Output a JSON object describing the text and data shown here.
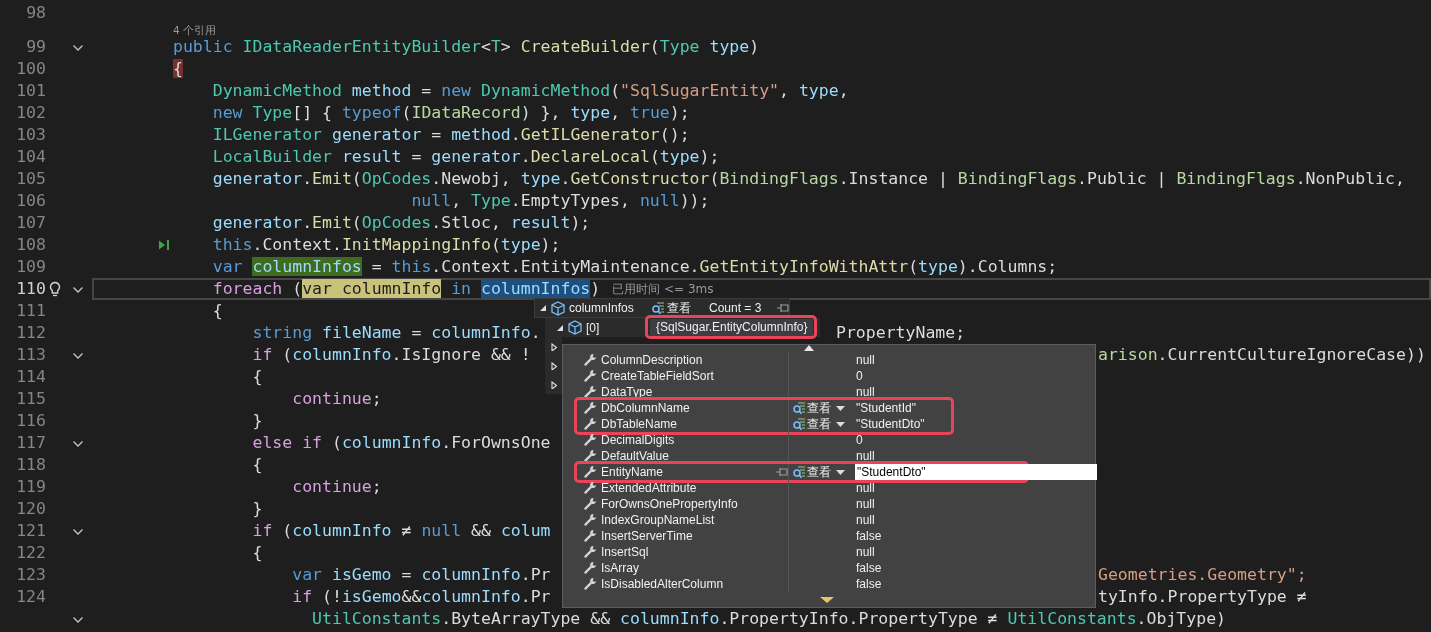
{
  "editor": {
    "lines": [
      {
        "number": "98",
        "current": false,
        "foldable": false
      },
      {
        "number": "99",
        "current": false,
        "foldable": true,
        "codelens": "4 个引用",
        "tokens": [
          {
            "text": "public ",
            "kind": "keyword"
          },
          {
            "text": "IDataReaderEntityBuilder",
            "kind": "type"
          },
          {
            "text": "<",
            "kind": "plain"
          },
          {
            "text": "T",
            "kind": "type"
          },
          {
            "text": "> ",
            "kind": "plain"
          },
          {
            "text": "CreateBuilder",
            "kind": "method"
          },
          {
            "text": "(",
            "kind": "plain"
          },
          {
            "text": "Type",
            "kind": "type"
          },
          {
            "text": " type",
            "kind": "variable"
          },
          {
            "text": ")",
            "kind": "plain"
          }
        ]
      },
      {
        "number": "100",
        "current": false,
        "foldable": false,
        "tokens": [
          {
            "text": "{",
            "kind": "plain",
            "color": "#7a2f2f"
          }
        ]
      },
      {
        "number": "101",
        "current": false,
        "foldable": false,
        "tokens": [
          {
            "text": "    DynamicMethod",
            "kind": "type"
          },
          {
            "text": " method",
            "kind": "variable"
          },
          {
            "text": " = ",
            "kind": "plain"
          },
          {
            "text": "new ",
            "kind": "keyword"
          },
          {
            "text": "DynamicMethod",
            "kind": "type"
          },
          {
            "text": "(",
            "kind": "plain"
          },
          {
            "text": "\"SqlSugarEntity\"",
            "kind": "string"
          },
          {
            "text": ", ",
            "kind": "plain"
          },
          {
            "text": "type",
            "kind": "variable"
          },
          {
            "text": ",",
            "kind": "plain"
          }
        ]
      },
      {
        "number": "102",
        "current": false,
        "foldable": false,
        "tokens": [
          {
            "text": "    new ",
            "kind": "keyword"
          },
          {
            "text": "Type",
            "kind": "type"
          },
          {
            "text": "[] { ",
            "kind": "plain"
          },
          {
            "text": "typeof",
            "kind": "keyword"
          },
          {
            "text": "(",
            "kind": "plain"
          },
          {
            "text": "IDataRecord",
            "kind": "enum"
          },
          {
            "text": ") }, ",
            "kind": "plain"
          },
          {
            "text": "type",
            "kind": "variable"
          },
          {
            "text": ", ",
            "kind": "plain"
          },
          {
            "text": "true",
            "kind": "keyword"
          },
          {
            "text": ");",
            "kind": "plain"
          }
        ]
      },
      {
        "number": "103",
        "current": false,
        "foldable": false,
        "tokens": [
          {
            "text": "    ILGenerator",
            "kind": "type"
          },
          {
            "text": " generator",
            "kind": "variable"
          },
          {
            "text": " = ",
            "kind": "plain"
          },
          {
            "text": "method",
            "kind": "variable"
          },
          {
            "text": ".",
            "kind": "plain"
          },
          {
            "text": "GetILGenerator",
            "kind": "method"
          },
          {
            "text": "();",
            "kind": "plain"
          }
        ]
      },
      {
        "number": "104",
        "current": false,
        "foldable": false,
        "tokens": [
          {
            "text": "    LocalBuilder",
            "kind": "type"
          },
          {
            "text": " result",
            "kind": "variable"
          },
          {
            "text": " = ",
            "kind": "plain"
          },
          {
            "text": "generator",
            "kind": "variable"
          },
          {
            "text": ".",
            "kind": "plain"
          },
          {
            "text": "DeclareLocal",
            "kind": "method"
          },
          {
            "text": "(",
            "kind": "plain"
          },
          {
            "text": "type",
            "kind": "variable"
          },
          {
            "text": ");",
            "kind": "plain"
          }
        ]
      },
      {
        "number": "105",
        "current": false,
        "foldable": false,
        "tokens": [
          {
            "text": "    generator",
            "kind": "variable"
          },
          {
            "text": ".",
            "kind": "plain"
          },
          {
            "text": "Emit",
            "kind": "method"
          },
          {
            "text": "(",
            "kind": "plain"
          },
          {
            "text": "OpCodes",
            "kind": "type"
          },
          {
            "text": ".Newobj, ",
            "kind": "plain"
          },
          {
            "text": "type",
            "kind": "variable"
          },
          {
            "text": ".",
            "kind": "plain"
          },
          {
            "text": "GetConstructor",
            "kind": "method"
          },
          {
            "text": "(",
            "kind": "plain"
          },
          {
            "text": "BindingFlags",
            "kind": "enum"
          },
          {
            "text": ".Instance | ",
            "kind": "plain"
          },
          {
            "text": "BindingFlags",
            "kind": "enum"
          },
          {
            "text": ".Public | ",
            "kind": "plain"
          },
          {
            "text": "BindingFlags",
            "kind": "enum"
          },
          {
            "text": ".NonPublic,",
            "kind": "plain"
          }
        ]
      },
      {
        "number": "106",
        "current": false,
        "foldable": false,
        "tokens": [
          {
            "text": "                        null",
            "kind": "keyword"
          },
          {
            "text": ", ",
            "kind": "plain"
          },
          {
            "text": "Type",
            "kind": "type"
          },
          {
            "text": ".EmptyTypes, ",
            "kind": "plain"
          },
          {
            "text": "null",
            "kind": "keyword"
          },
          {
            "text": "));",
            "kind": "plain"
          }
        ]
      },
      {
        "number": "107",
        "current": false,
        "foldable": false,
        "tokens": [
          {
            "text": "    generator",
            "kind": "variable"
          },
          {
            "text": ".",
            "kind": "plain"
          },
          {
            "text": "Emit",
            "kind": "method"
          },
          {
            "text": "(",
            "kind": "plain"
          },
          {
            "text": "OpCodes",
            "kind": "type"
          },
          {
            "text": ".Stloc, ",
            "kind": "plain"
          },
          {
            "text": "result",
            "kind": "variable"
          },
          {
            "text": ");",
            "kind": "plain"
          }
        ]
      },
      {
        "number": "108",
        "current": false,
        "foldable": false,
        "run_to_cursor": true,
        "tokens": [
          {
            "text": "    this",
            "kind": "keyword"
          },
          {
            "text": ".Context.",
            "kind": "plain"
          },
          {
            "text": "InitMappingInfo",
            "kind": "method"
          },
          {
            "text": "(",
            "kind": "plain"
          },
          {
            "text": "type",
            "kind": "variable"
          },
          {
            "text": ");",
            "kind": "plain"
          }
        ]
      },
      {
        "number": "109",
        "current": false,
        "foldable": false,
        "tokens": [
          {
            "text": "    var ",
            "kind": "keyword"
          },
          {
            "text": "columnInfos",
            "kind": "variable",
            "color": "#3f6b1f"
          },
          {
            "text": " = ",
            "kind": "plain"
          },
          {
            "text": "this",
            "kind": "keyword"
          },
          {
            "text": ".Context.EntityMaintenance.",
            "kind": "plain"
          },
          {
            "text": "GetEntityInfoWithAttr",
            "kind": "method"
          },
          {
            "text": "(",
            "kind": "plain"
          },
          {
            "text": "type",
            "kind": "variable"
          },
          {
            "text": ").Columns;",
            "kind": "plain"
          }
        ]
      },
      {
        "number": "110",
        "current": true,
        "foldable": true,
        "lightbulb": true,
        "hint": "已用时间 <= 3ms",
        "tokens": [
          {
            "text": "    foreach",
            "kind": "control"
          },
          {
            "text": " (",
            "kind": "plain"
          },
          {
            "text": "var",
            "kind": "keyword",
            "color": "#c8c27a"
          },
          {
            "text": " columnInfo",
            "kind": "variable",
            "color": "#c8c27a"
          },
          {
            "text": " in ",
            "kind": "keyword"
          },
          {
            "text": "columnInfos",
            "kind": "variable",
            "color": "#1d4f80"
          },
          {
            "text": ")",
            "kind": "plain"
          }
        ]
      },
      {
        "number": "111",
        "current": false,
        "foldable": false,
        "tokens": [
          {
            "text": "    {",
            "kind": "plain"
          }
        ]
      },
      {
        "number": "112",
        "current": false,
        "foldable": false,
        "tokens": [
          {
            "text": "        string",
            "kind": "keyword"
          },
          {
            "text": " fileName",
            "kind": "variable"
          },
          {
            "text": " = ",
            "kind": "plain"
          },
          {
            "text": "columnInfo",
            "kind": "variable"
          },
          {
            "text": ".",
            "kind": "plain"
          }
        ],
        "tail": [
          {
            "text": "PropertyName;",
            "kind": "plain"
          }
        ]
      },
      {
        "number": "113",
        "current": false,
        "foldable": true,
        "tokens": [
          {
            "text": "        if",
            "kind": "control"
          },
          {
            "text": " (",
            "kind": "plain"
          },
          {
            "text": "columnInfo",
            "kind": "variable"
          },
          {
            "text": ".IsIgnore && !",
            "kind": "plain"
          }
        ],
        "tail": [
          {
            "text": "arison",
            "kind": "enum"
          },
          {
            "text": ".CurrentCultureIgnoreCase))",
            "kind": "plain"
          }
        ]
      },
      {
        "number": "114",
        "current": false,
        "foldable": false,
        "tokens": [
          {
            "text": "        {",
            "kind": "plain"
          }
        ]
      },
      {
        "number": "115",
        "current": false,
        "foldable": false,
        "tokens": [
          {
            "text": "            continue",
            "kind": "control"
          },
          {
            "text": ";",
            "kind": "plain"
          }
        ]
      },
      {
        "number": "116",
        "current": false,
        "foldable": false,
        "tokens": [
          {
            "text": "        }",
            "kind": "plain"
          }
        ]
      },
      {
        "number": "117",
        "current": false,
        "foldable": true,
        "tokens": [
          {
            "text": "        else if",
            "kind": "control"
          },
          {
            "text": " (",
            "kind": "plain"
          },
          {
            "text": "columnInfo",
            "kind": "variable"
          },
          {
            "text": ".ForOwnsOne",
            "kind": "plain"
          }
        ]
      },
      {
        "number": "118",
        "current": false,
        "foldable": false,
        "tokens": [
          {
            "text": "        {",
            "kind": "plain"
          }
        ]
      },
      {
        "number": "119",
        "current": false,
        "foldable": false,
        "tokens": [
          {
            "text": "            continue",
            "kind": "control"
          },
          {
            "text": ";",
            "kind": "plain"
          }
        ]
      },
      {
        "number": "120",
        "current": false,
        "foldable": false,
        "tokens": [
          {
            "text": "        }",
            "kind": "plain"
          }
        ]
      },
      {
        "number": "121",
        "current": false,
        "foldable": true,
        "tokens": [
          {
            "text": "        if",
            "kind": "control"
          },
          {
            "text": " (",
            "kind": "plain"
          },
          {
            "text": "columnInfo",
            "kind": "variable"
          },
          {
            "text": " ≠ ",
            "kind": "plain"
          },
          {
            "text": "null",
            "kind": "keyword"
          },
          {
            "text": " && ",
            "kind": "plain"
          },
          {
            "text": "colum",
            "kind": "variable"
          }
        ]
      },
      {
        "number": "122",
        "current": false,
        "foldable": false,
        "tokens": [
          {
            "text": "        {",
            "kind": "plain"
          }
        ]
      },
      {
        "number": "123",
        "current": false,
        "foldable": false,
        "tokens": [
          {
            "text": "            var",
            "kind": "keyword"
          },
          {
            "text": " isGemo",
            "kind": "variable"
          },
          {
            "text": " = ",
            "kind": "plain"
          },
          {
            "text": "columnInfo",
            "kind": "variable"
          },
          {
            "text": ".Pr",
            "kind": "plain"
          }
        ],
        "tail": [
          {
            "text": "Geometries.Geometry\";",
            "kind": "string"
          }
        ]
      },
      {
        "number": "124",
        "current": false,
        "foldable": false,
        "tokens": [
          {
            "text": "            if",
            "kind": "control"
          },
          {
            "text": " (!",
            "kind": "plain"
          },
          {
            "text": "isGemo",
            "kind": "variable"
          },
          {
            "text": "&&",
            "kind": "plain"
          },
          {
            "text": "columnInfo",
            "kind": "variable"
          },
          {
            "text": ".Pr",
            "kind": "plain"
          }
        ],
        "tail": [
          {
            "text": "tyInfo.PropertyType ≠",
            "kind": "plain"
          }
        ]
      },
      {
        "current": false,
        "foldable": true,
        "tokens": [
          {
            "text": "              UtilConstants",
            "kind": "type"
          },
          {
            "text": ".ByteArrayType && ",
            "kind": "plain"
          },
          {
            "text": "columnInfo",
            "kind": "variable"
          },
          {
            "text": ".PropertyInfo.PropertyType ≠ ",
            "kind": "plain"
          },
          {
            "text": "UtilConstants",
            "kind": "type"
          },
          {
            "text": ".ObjType)",
            "kind": "plain"
          }
        ]
      }
    ]
  },
  "datatip": {
    "root": {
      "name": "columnInfos",
      "expanded": true,
      "visualizer": "查看",
      "value": "Count = 3",
      "pin_shown": true
    },
    "items": [
      {
        "name": "[0]",
        "expanded": true,
        "value": "{SqlSugar.EntityColumnInfo}",
        "outlined": true
      },
      {
        "expanded": false
      },
      {
        "expanded": false
      },
      {
        "expanded": false
      }
    ],
    "properties": [
      {
        "name": "ColumnDescription",
        "value": "null",
        "outlined": false,
        "editing": false
      },
      {
        "name": "CreateTableFieldSort",
        "value": "0",
        "outlined": false,
        "editing": false
      },
      {
        "name": "DataType",
        "value": "null",
        "outlined": false,
        "editing": false
      },
      {
        "name": "DbColumnName",
        "visualizer": "查看",
        "value": "\"StudentId\"",
        "outlined": true,
        "editing": false
      },
      {
        "name": "DbTableName",
        "visualizer": "查看",
        "value": "\"StudentDto\"",
        "outlined": true,
        "editing": false
      },
      {
        "name": "DecimalDigits",
        "value": "0",
        "outlined": false,
        "editing": false
      },
      {
        "name": "DefaultValue",
        "value": "null",
        "outlined": false,
        "editing": false
      },
      {
        "name": "EntityName",
        "visualizer": "查看",
        "value": "\"StudentDto\"",
        "outlined": true,
        "editing": true,
        "pin_shown": true
      },
      {
        "name": "ExtendedAttribute",
        "value": "null",
        "outlined": false,
        "editing": false
      },
      {
        "name": "ForOwnsOnePropertyInfo",
        "value": "null",
        "outlined": false,
        "editing": false
      },
      {
        "name": "IndexGroupNameList",
        "value": "null",
        "outlined": false,
        "editing": false
      },
      {
        "name": "InsertServerTime",
        "value": "false",
        "outlined": false,
        "editing": false
      },
      {
        "name": "InsertSql",
        "value": "null",
        "outlined": false,
        "editing": false
      },
      {
        "name": "IsArray",
        "value": "false",
        "outlined": false,
        "editing": false
      },
      {
        "name": "IsDisabledAlterColumn",
        "value": "false",
        "outlined": false,
        "editing": false
      }
    ]
  }
}
